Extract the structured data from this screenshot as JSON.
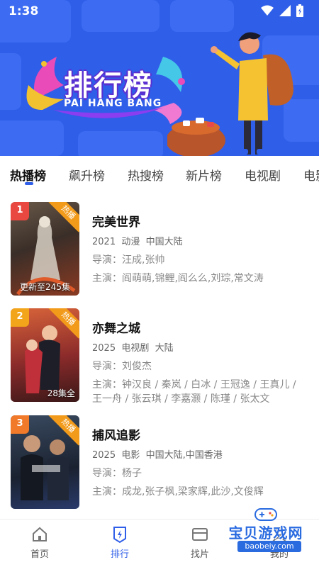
{
  "status_bar": {
    "time": "1:38"
  },
  "banner": {
    "title": "排行榜",
    "subtitle": "PAI HANG BANG"
  },
  "tabs": [
    {
      "label": "热播榜",
      "active": true
    },
    {
      "label": "飙升榜",
      "active": false
    },
    {
      "label": "热搜榜",
      "active": false
    },
    {
      "label": "新片榜",
      "active": false
    },
    {
      "label": "电视剧",
      "active": false
    },
    {
      "label": "电影",
      "active": false
    }
  ],
  "items": [
    {
      "rank": "1",
      "badge": "热播",
      "poster_caption": "更新至245集",
      "title": "完美世界",
      "year": "2021",
      "genre": "动漫",
      "region": "中国大陆",
      "director": "导演：汪成,张帅",
      "cast": "主演：阎萌萌,锦鲤,阎么么,刘琮,常文涛",
      "rank_color": "#e8483f"
    },
    {
      "rank": "2",
      "badge": "热播",
      "poster_caption": "28集全",
      "title": "亦舞之城",
      "year": "2025",
      "genre": "电视剧",
      "region": "大陆",
      "director": "导演：刘俊杰",
      "cast": "主演：钟汉良 / 秦岚 / 白冰 / 王冠逸 / 王真儿 / 王一舟 / 张云琪 / 李嘉灏 / 陈瑾 / 张太文",
      "rank_color": "#f2a51a"
    },
    {
      "rank": "3",
      "badge": "热播",
      "poster_caption": "",
      "title": "捕风追影",
      "year": "2025",
      "genre": "电影",
      "region": "中国大陆,中国香港",
      "director": "导演：杨子",
      "cast": "主演：成龙,张子枫,梁家辉,此沙,文俊辉",
      "rank_color": "#f07a2a"
    }
  ],
  "bottom_nav": [
    {
      "label": "首页",
      "icon": "home-icon",
      "active": false
    },
    {
      "label": "排行",
      "icon": "ranking-icon",
      "active": true
    },
    {
      "label": "找片",
      "icon": "find-icon",
      "active": false
    },
    {
      "label": "我的",
      "icon": "profile-icon",
      "active": false
    }
  ],
  "watermark": {
    "text": "宝贝游戏网",
    "url": "baobeiy.com"
  },
  "colors": {
    "accent": "#2f5ee8",
    "banner_bg": "#2f5ee8",
    "badge": "#f29a1a"
  }
}
